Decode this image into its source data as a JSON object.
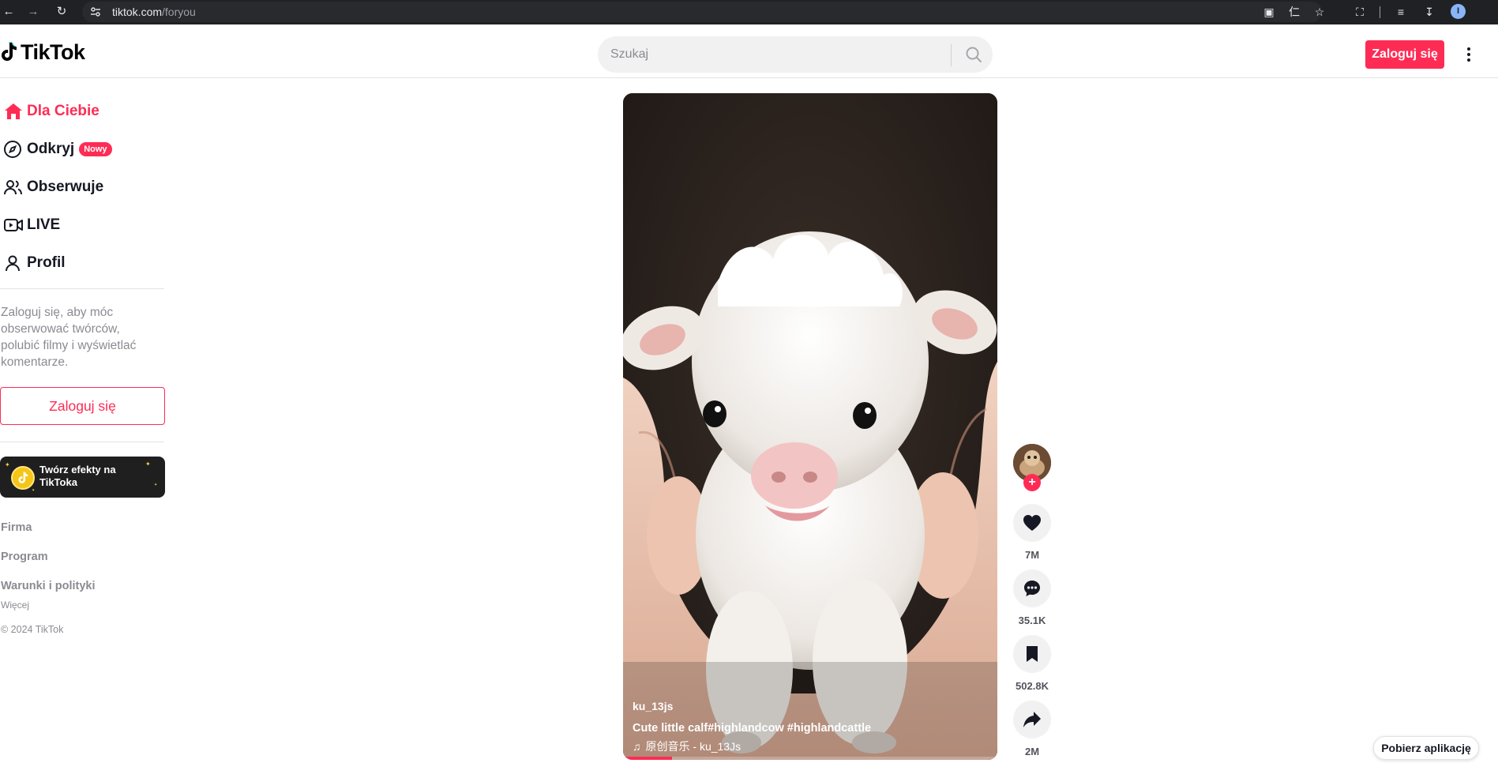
{
  "browser": {
    "url_host": "tiktok.com",
    "url_path": "/foryou",
    "profile_initial": "I"
  },
  "header": {
    "logo_text": "TikTok",
    "search_placeholder": "Szukaj",
    "login_label": "Zaloguj się"
  },
  "sidebar": {
    "items": [
      {
        "label": "Dla Ciebie",
        "icon": "home-icon",
        "active": true
      },
      {
        "label": "Odkryj",
        "icon": "compass-icon",
        "badge": "Nowy"
      },
      {
        "label": "Obserwuje",
        "icon": "users-icon"
      },
      {
        "label": "LIVE",
        "icon": "live-camera-icon"
      },
      {
        "label": "Profil",
        "icon": "person-icon"
      }
    ],
    "login_message": "Zaloguj się, aby móc obserwować twórców, polubić filmy i wyświetlać komentarze.",
    "login_button": "Zaloguj się",
    "effects_banner": "Twórz efekty na TikToka",
    "footer": {
      "company": "Firma",
      "program": "Program",
      "terms": "Warunki i polityki",
      "more": "Więcej",
      "copyright": "© 2024 TikTok"
    }
  },
  "video": {
    "username": "ku_13js",
    "caption": "Cute little calf#highlandcow  #highlandcattle",
    "music": "原创音乐 - ku_13Js",
    "progress": 0.13
  },
  "actions": {
    "likes": "7M",
    "comments": "35.1K",
    "saves": "502.8K",
    "shares": "2M"
  },
  "get_app_label": "Pobierz aplikację",
  "colors": {
    "accent": "#fe2c55",
    "text": "#161823",
    "muted": "#8a8b91"
  }
}
